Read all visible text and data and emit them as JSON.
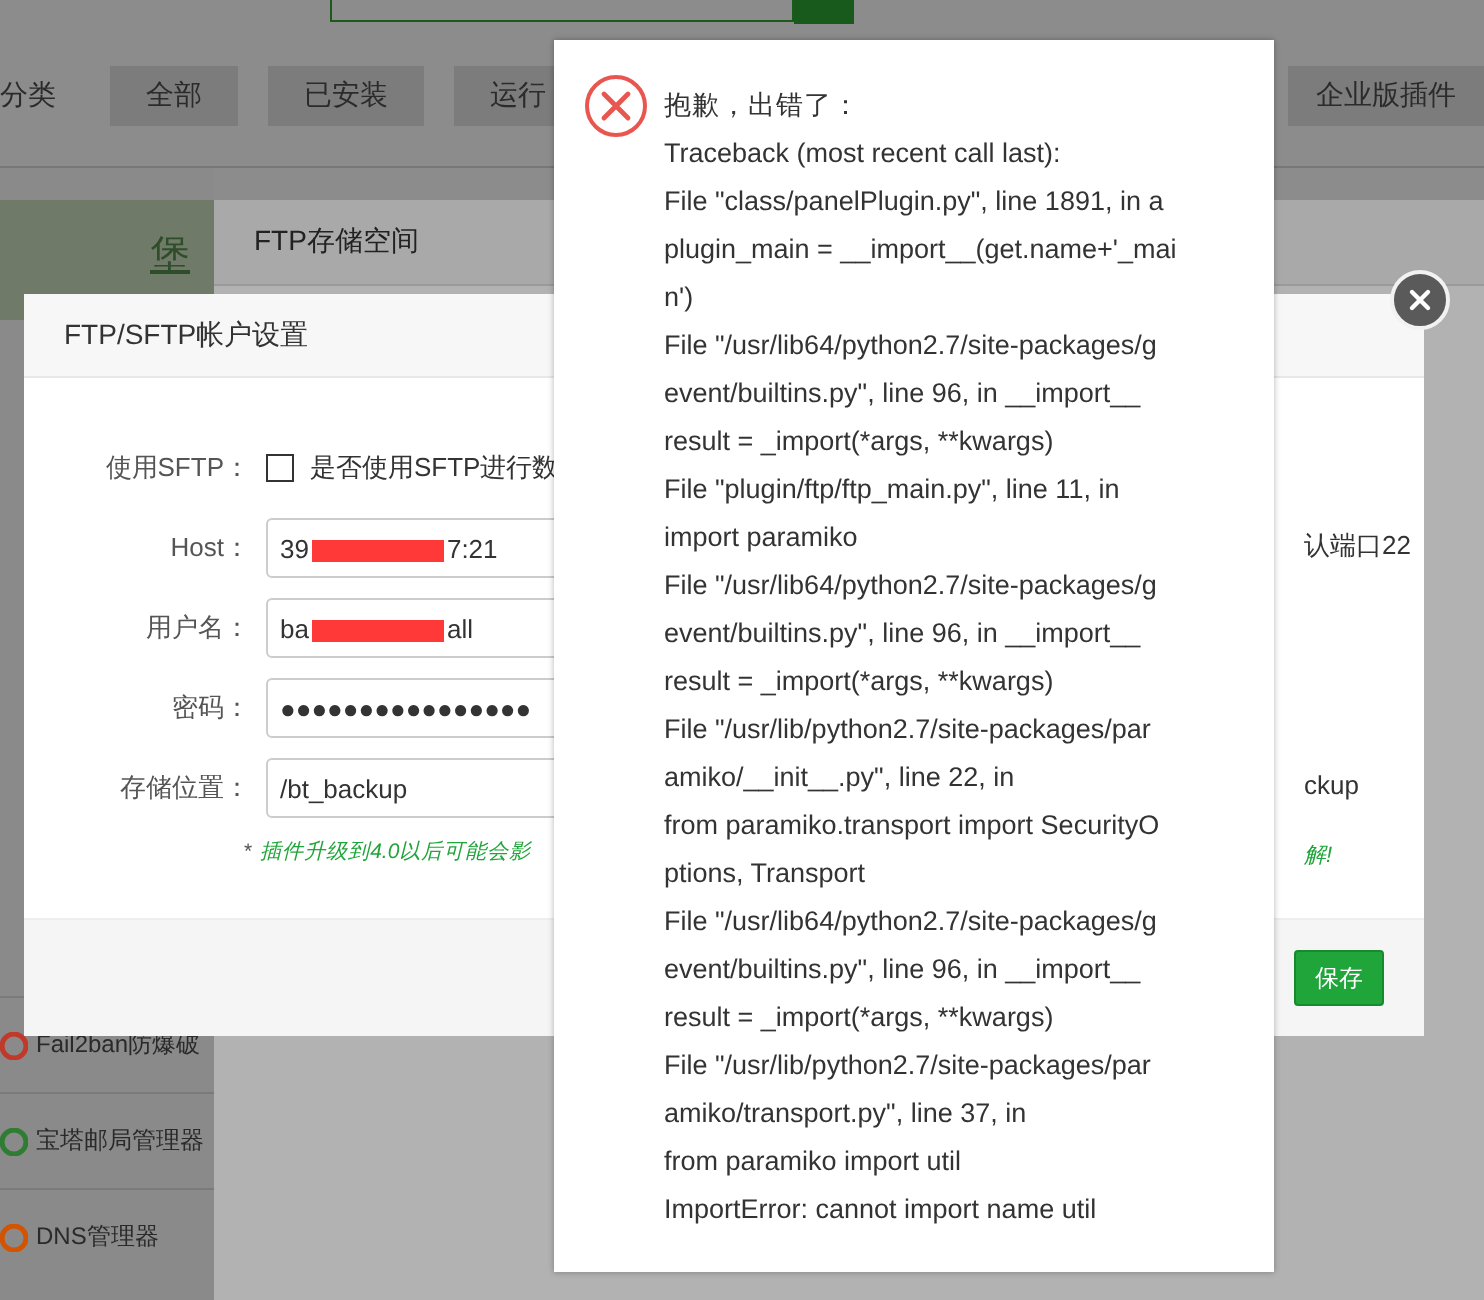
{
  "page": {
    "category_label": "分类",
    "category_buttons": [
      {
        "label": "全部"
      },
      {
        "label": "已安装"
      },
      {
        "label": "运行"
      },
      {
        "label": "企业版插件"
      }
    ],
    "banner_link": "堡",
    "sidebar_items": [
      {
        "label": "Fail2ban防爆破"
      },
      {
        "label": "宝塔邮局管理器"
      },
      {
        "label": "DNS管理器"
      }
    ]
  },
  "ftp_window": {
    "title": "FTP存储空间",
    "side_texts": [
      {
        "text": "认端口22",
        "kind": "plain"
      },
      {
        "text": "ckup",
        "kind": "plain"
      },
      {
        "text": "解!",
        "kind": "note"
      }
    ]
  },
  "modal": {
    "title": "FTP/SFTP帐户设置",
    "sftp": {
      "label": "使用SFTP：",
      "checked": false,
      "text": "是否使用SFTP进行数"
    },
    "fields": [
      {
        "label": "Host：",
        "value_start": "39",
        "value_end": "7:21",
        "redacted": true
      },
      {
        "label": "用户名：",
        "value_start": "ba",
        "value_end": "all",
        "redacted": true
      },
      {
        "label": "密码：",
        "value_start": "●●●●●●●●●●●●●●●●",
        "redacted": false
      },
      {
        "label": "存储位置：",
        "value_start": "/bt_backup",
        "redacted": false
      }
    ],
    "note_mark": "*",
    "note": "插件升级到4.0以后可能会影",
    "save_button": "保存"
  },
  "error_dialog": {
    "lines": [
      "抱歉，出错了：",
      "Traceback (most recent call last):",
      "File \"class/panelPlugin.py\", line 1891, in a",
      "plugin_main = __import__(get.name+'_mai",
      "n')",
      "File \"/usr/lib64/python2.7/site-packages/g",
      "event/builtins.py\", line 96, in __import__",
      "result = _import(*args, **kwargs)",
      "File \"plugin/ftp/ftp_main.py\", line 11, in",
      "import paramiko",
      "File \"/usr/lib64/python2.7/site-packages/g",
      "event/builtins.py\", line 96, in __import__",
      "result = _import(*args, **kwargs)",
      "File \"/usr/lib/python2.7/site-packages/par",
      "amiko/__init__.py\", line 22, in",
      "from paramiko.transport import SecurityO",
      "ptions, Transport",
      "File \"/usr/lib64/python2.7/site-packages/g",
      "event/builtins.py\", line 96, in __import__",
      "result = _import(*args, **kwargs)",
      "File \"/usr/lib/python2.7/site-packages/par",
      "amiko/transport.py\", line 37, in",
      "from paramiko import util",
      "ImportError: cannot import name util"
    ]
  }
}
